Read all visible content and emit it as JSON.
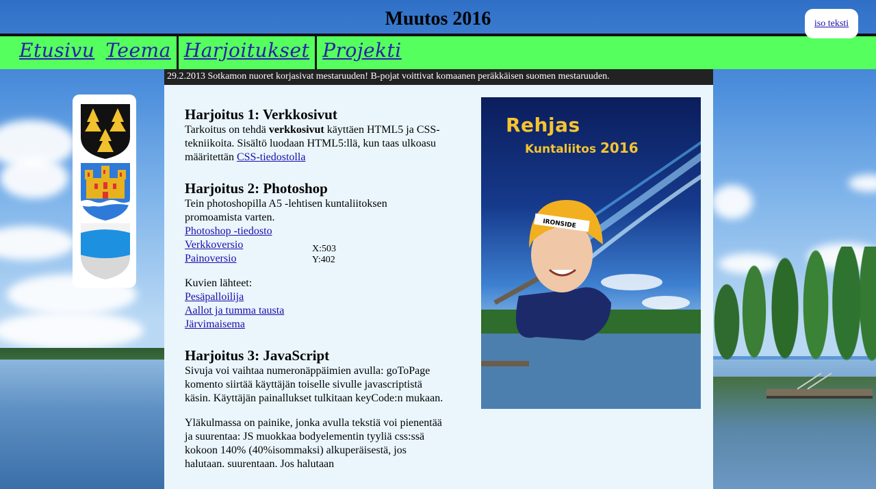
{
  "header": {
    "title": "Muutos 2016",
    "bigtext_label": "iso teksti"
  },
  "nav": {
    "items": [
      "Etusivu",
      "Teema",
      "Harjoitukset",
      "Projekti"
    ],
    "active": "Harjoitukset"
  },
  "ticker": {
    "text": "29.2.2013 Sotkamon nuoret korjasivat mestaruuden! B-pojat voittivat komaanen peräkkäisen suomen mestaruuden."
  },
  "sections": {
    "s1": {
      "title": "Harjoitus 1: Verkkosivut",
      "text_a": "Tarkoitus on tehdä ",
      "text_bold": "verkkosivut",
      "text_b": " käyttäen HTML5 ja CSS-tekniikoita. Sisältö luodaan HTML5:llä, kun taas ulkoasu määritettän ",
      "link": "CSS-tiedostolla"
    },
    "s2": {
      "title": "Harjoitus 2: Photoshop",
      "text": "Tein photoshopilla A5 -lehtisen kuntaliitoksen promoamista varten.",
      "links": [
        "Photoshop -tiedosto",
        "Verkkoversio",
        "Painoversio"
      ],
      "sources_label": "Kuvien lähteet:",
      "source_links": [
        "Pesäpalloilija",
        "Aallot ja tumma tausta",
        "Järvimaisema"
      ]
    },
    "s3": {
      "title": "Harjoitus 3: JavaScript",
      "text1": "Sivuja voi vaihtaa numeronäppäimien avulla: goToPage komento siirtää käyttäjän toiselle sivulle javascriptistä käsin. Käyttäjän painallukset tulkitaan keyCode:n mukaan.",
      "text2": "Yläkulmassa on painike, jonka avulla tekstiä voi pienentää ja suurentaa: JS muokkaa bodyelementin tyyliä css:ssä kokoon 140% (40%isommaksi) alkuperäisestä, jos halutaan. suurentaan. Jos halutaan"
    }
  },
  "coords": {
    "x": "X:503",
    "y": "Y:402"
  },
  "poster": {
    "title": "Rehjas",
    "subtitle": "Kuntaliitos",
    "year": "2016",
    "helmet_text": "IRONSIDE"
  },
  "colors": {
    "nav_bg": "#55ff5d",
    "link": "#1a0dab",
    "main_bg": "#eaf6fc",
    "ticker_bg": "#222222",
    "poster_text": "#f6c430"
  }
}
